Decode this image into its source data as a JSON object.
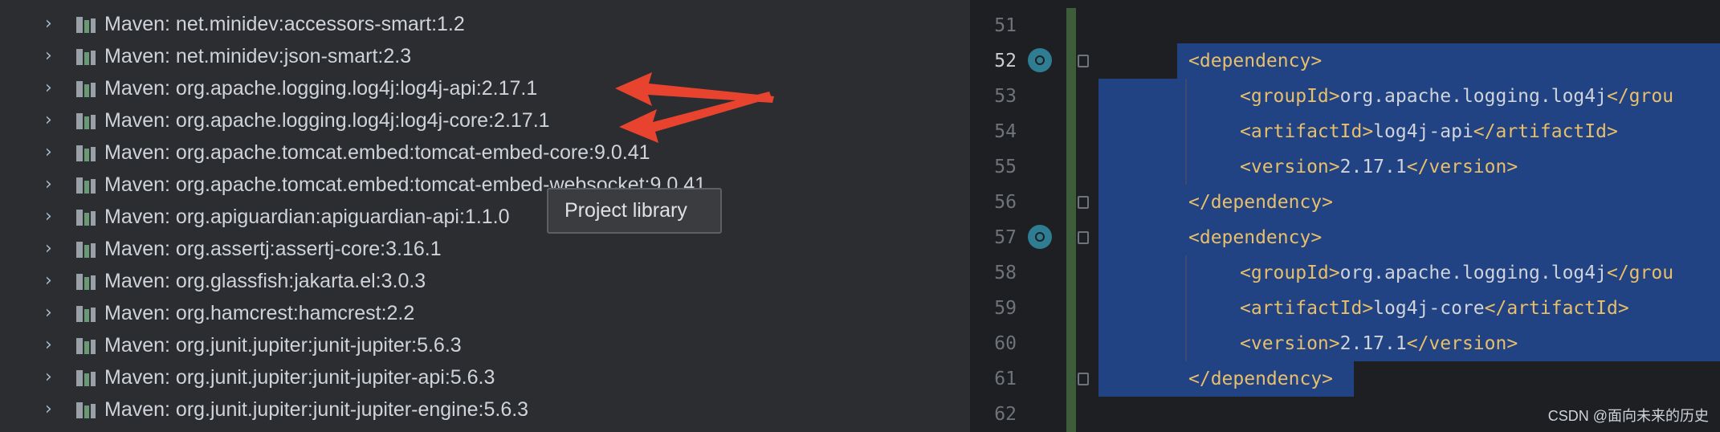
{
  "tree": {
    "items": [
      {
        "label": "Maven: net.minidev:accessors-smart:1.2"
      },
      {
        "label": "Maven: net.minidev:json-smart:2.3"
      },
      {
        "label": "Maven: org.apache.logging.log4j:log4j-api:2.17.1"
      },
      {
        "label": "Maven: org.apache.logging.log4j:log4j-core:2.17.1"
      },
      {
        "label": "Maven: org.apache.tomcat.embed:tomcat-embed-core:9.0.41"
      },
      {
        "label": "Maven: org.apache.tomcat.embed:tomcat-embed-websocket:9.0.41"
      },
      {
        "label": "Maven: org.apiguardian:apiguardian-api:1.1.0"
      },
      {
        "label": "Maven: org.assertj:assertj-core:3.16.1"
      },
      {
        "label": "Maven: org.glassfish:jakarta.el:3.0.3"
      },
      {
        "label": "Maven: org.hamcrest:hamcrest:2.2"
      },
      {
        "label": "Maven: org.junit.jupiter:junit-jupiter:5.6.3"
      },
      {
        "label": "Maven: org.junit.jupiter:junit-jupiter-api:5.6.3"
      },
      {
        "label": "Maven: org.junit.jupiter:junit-jupiter-engine:5.6.3"
      }
    ]
  },
  "tooltip": {
    "text": "Project library"
  },
  "editor": {
    "lines": [
      {
        "num": "51",
        "tag_open": "",
        "text": "",
        "tag_close": ""
      },
      {
        "num": "52",
        "tag_open": "<dependency>",
        "text": "",
        "tag_close": ""
      },
      {
        "num": "53",
        "tag_open": "<groupId>",
        "text": "org.apache.logging.log4j",
        "tag_close": "</grou"
      },
      {
        "num": "54",
        "tag_open": "<artifactId>",
        "text": "log4j-api",
        "tag_close": "</artifactId>"
      },
      {
        "num": "55",
        "tag_open": "<version>",
        "text": "2.17.1",
        "tag_close": "</version>"
      },
      {
        "num": "56",
        "tag_open": "</dependency>",
        "text": "",
        "tag_close": ""
      },
      {
        "num": "57",
        "tag_open": "<dependency>",
        "text": "",
        "tag_close": ""
      },
      {
        "num": "58",
        "tag_open": "<groupId>",
        "text": "org.apache.logging.log4j",
        "tag_close": "</grou"
      },
      {
        "num": "59",
        "tag_open": "<artifactId>",
        "text": "log4j-core",
        "tag_close": "</artifactId>"
      },
      {
        "num": "60",
        "tag_open": "<version>",
        "text": "2.17.1",
        "tag_close": "</version>"
      },
      {
        "num": "61",
        "tag_open": "</dependency>",
        "text": "",
        "tag_close": ""
      },
      {
        "num": "62",
        "tag_open": "",
        "text": "",
        "tag_close": ""
      }
    ]
  },
  "watermark": "CSDN @面向未来的历史",
  "colors": {
    "selection": "#214283",
    "tag": "#e8bf6a",
    "arrow": "#e8432f",
    "marker": "#2f7d92"
  }
}
